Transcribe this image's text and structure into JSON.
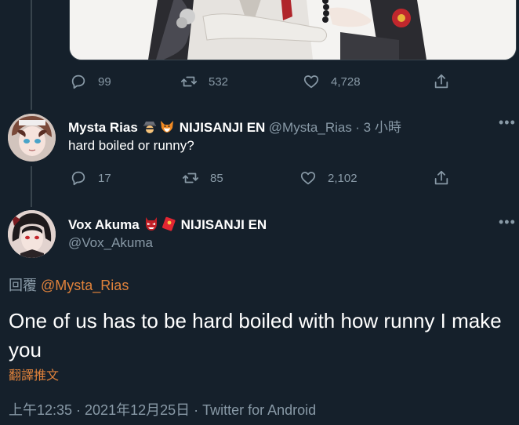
{
  "top_tweet": {
    "actions": {
      "reply_count": "99",
      "retweet_count": "532",
      "like_count": "4,728"
    }
  },
  "reply_tweet": {
    "display_name": "Mysta Rias",
    "affiliation": "NIJISANJI EN",
    "handle": "@Mysta_Rias",
    "time": "· 3 小時",
    "text": "hard boiled or runny?",
    "actions": {
      "reply_count": "17",
      "retweet_count": "85",
      "like_count": "2,102"
    }
  },
  "main_tweet": {
    "display_name": "Vox Akuma",
    "affiliation": "NIJISANJI EN",
    "handle": "@Vox_Akuma",
    "replying_prefix": "回覆",
    "replying_to": "@Mysta_Rias",
    "text": "One of us has to be hard boiled with how runny I make you",
    "translate": "翻譯推文",
    "timestamp": "上午12:35 · 2021年12月25日 · Twitter for Android"
  },
  "colors": {
    "background": "#15202b",
    "muted": "#8899a6",
    "accent": "#e0823b",
    "divider": "#38444d"
  }
}
